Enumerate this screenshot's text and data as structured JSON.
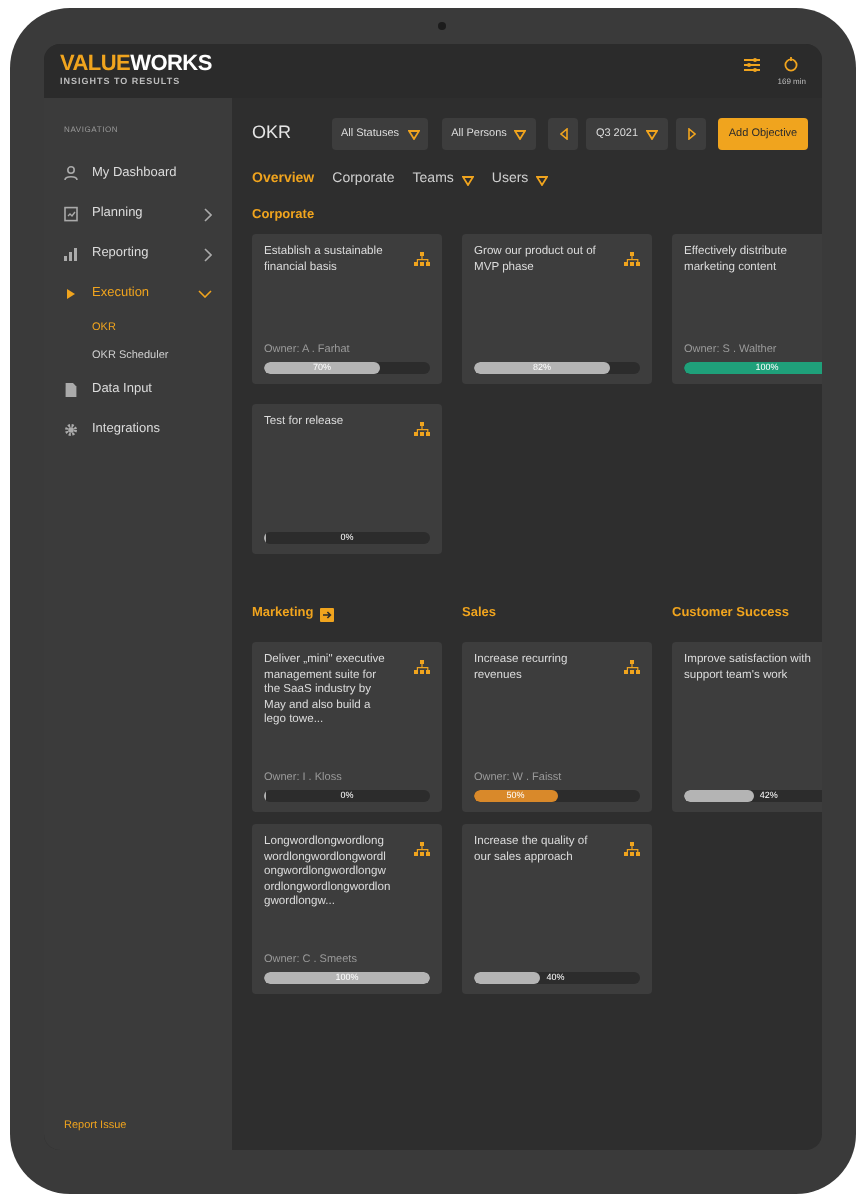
{
  "logo": {
    "part_1": "VALUE",
    "part_2": "WORKS",
    "tagline": "INSIGHTS TO RESULTS"
  },
  "header": {
    "timer": "169 min"
  },
  "sidebar": {
    "heading": "NAVIGATION",
    "items": [
      {
        "label": "My Dashboard",
        "kind": "link",
        "selected": false
      },
      {
        "label": "Planning",
        "kind": "group",
        "expanded": false,
        "selected": false
      },
      {
        "label": "Reporting",
        "kind": "group",
        "expanded": false,
        "selected": false
      },
      {
        "label": "Execution",
        "kind": "group",
        "expanded": true,
        "selected": true,
        "children": [
          {
            "label": "OKR",
            "selected": true
          },
          {
            "label": "OKR Scheduler",
            "selected": false
          }
        ]
      },
      {
        "label": "Data Input",
        "kind": "link",
        "selected": false
      },
      {
        "label": "Integrations",
        "kind": "link",
        "selected": false
      }
    ],
    "footer_link": "Report Issue"
  },
  "page_title": "OKR",
  "toolbar": {
    "status_filter": "All Statuses",
    "person_filter": "All Persons",
    "period": "Q3 2021",
    "add_button": "Add Objective"
  },
  "tabs": [
    {
      "label": "Overview",
      "selected": true,
      "dropdown": false
    },
    {
      "label": "Corporate",
      "selected": false,
      "dropdown": false
    },
    {
      "label": "Teams",
      "selected": false,
      "dropdown": true
    },
    {
      "label": "Users",
      "selected": false,
      "dropdown": true
    }
  ],
  "corporate": {
    "title": "Corporate",
    "objectives": [
      {
        "title": "Establish a sustainable financial basis",
        "owner": "Owner: A . Farhat",
        "level": 0.7,
        "progress": "70%",
        "color": "#b4b4b4"
      },
      {
        "title": "Grow our product out of MVP phase",
        "level": 0.82,
        "progress": "82%",
        "color": "#b4b4b4"
      },
      {
        "title": "Effectively distribute marketing content",
        "owner": "Owner: S . Walther",
        "level": 1,
        "progress": "100%",
        "color": "#1fa07a"
      },
      {
        "title": "Test for release",
        "level": 0,
        "progress": "0%"
      }
    ]
  },
  "teams": [
    {
      "title": "Marketing",
      "link_icon": true,
      "objectives": [
        {
          "title": "Deliver „mini\" executive management suite for the SaaS industry by May and also build a lego towe...",
          "owner": "Owner: I . Kloss",
          "level": 0,
          "progress": "0%"
        },
        {
          "title": "Longwordlongwordlongwordlongwordlongwordlongwordlongwordlongwordlongwordlongwordlongwordlongw...",
          "owner": "Owner: C . Smeets",
          "level": 1,
          "progress": "100%",
          "color": "#b4b4b4"
        }
      ]
    },
    {
      "title": "Sales",
      "link_icon": false,
      "objectives": [
        {
          "title": "Increase recurring revenues",
          "owner": "Owner: W . Faisst",
          "level": 0.5,
          "progress": "50%",
          "color": "#d9892a"
        },
        {
          "title": "Increase the quality of our sales approach",
          "level": 0.4,
          "progress": "40%",
          "color": "#b4b4b4"
        }
      ]
    },
    {
      "title": "Customer Success",
      "link_icon": false,
      "objectives": [
        {
          "title": "Improve satisfaction with support team's work",
          "level": 0.42,
          "progress": "42%",
          "color": "#b4b4b4"
        }
      ]
    }
  ]
}
